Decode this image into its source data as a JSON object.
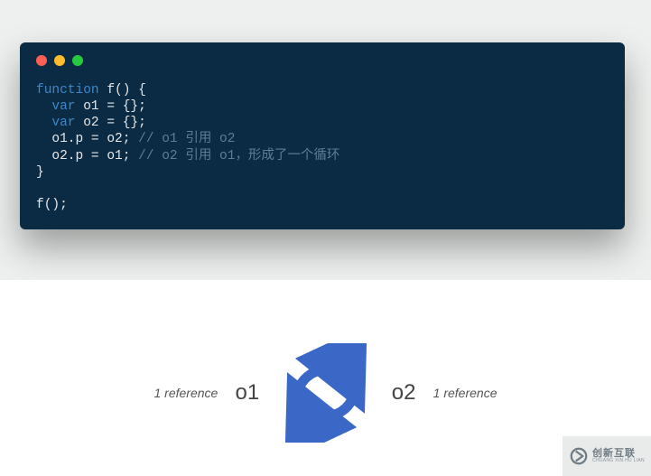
{
  "code": {
    "line1_kw": "function",
    "line1_rest": " f() {",
    "line2_kw": "  var",
    "line2_rest": " o1 = {};",
    "line3_kw": "  var",
    "line3_rest": " o2 = {};",
    "line4_code": "  o1.p = o2; ",
    "line4_comment": "// o1 引用 o2",
    "line5_code": "  o2.p = o1; ",
    "line5_comment": "// o2 引用 o1，形成了一个循环",
    "line6": "}",
    "line7": "",
    "line8": "f();"
  },
  "diagram": {
    "ref_left": "1 reference",
    "node_left": "o1",
    "node_right": "o2",
    "ref_right": "1 reference"
  },
  "watermark": {
    "cn": "创新互联",
    "en": "CHUANG XIN HU LIAN"
  }
}
